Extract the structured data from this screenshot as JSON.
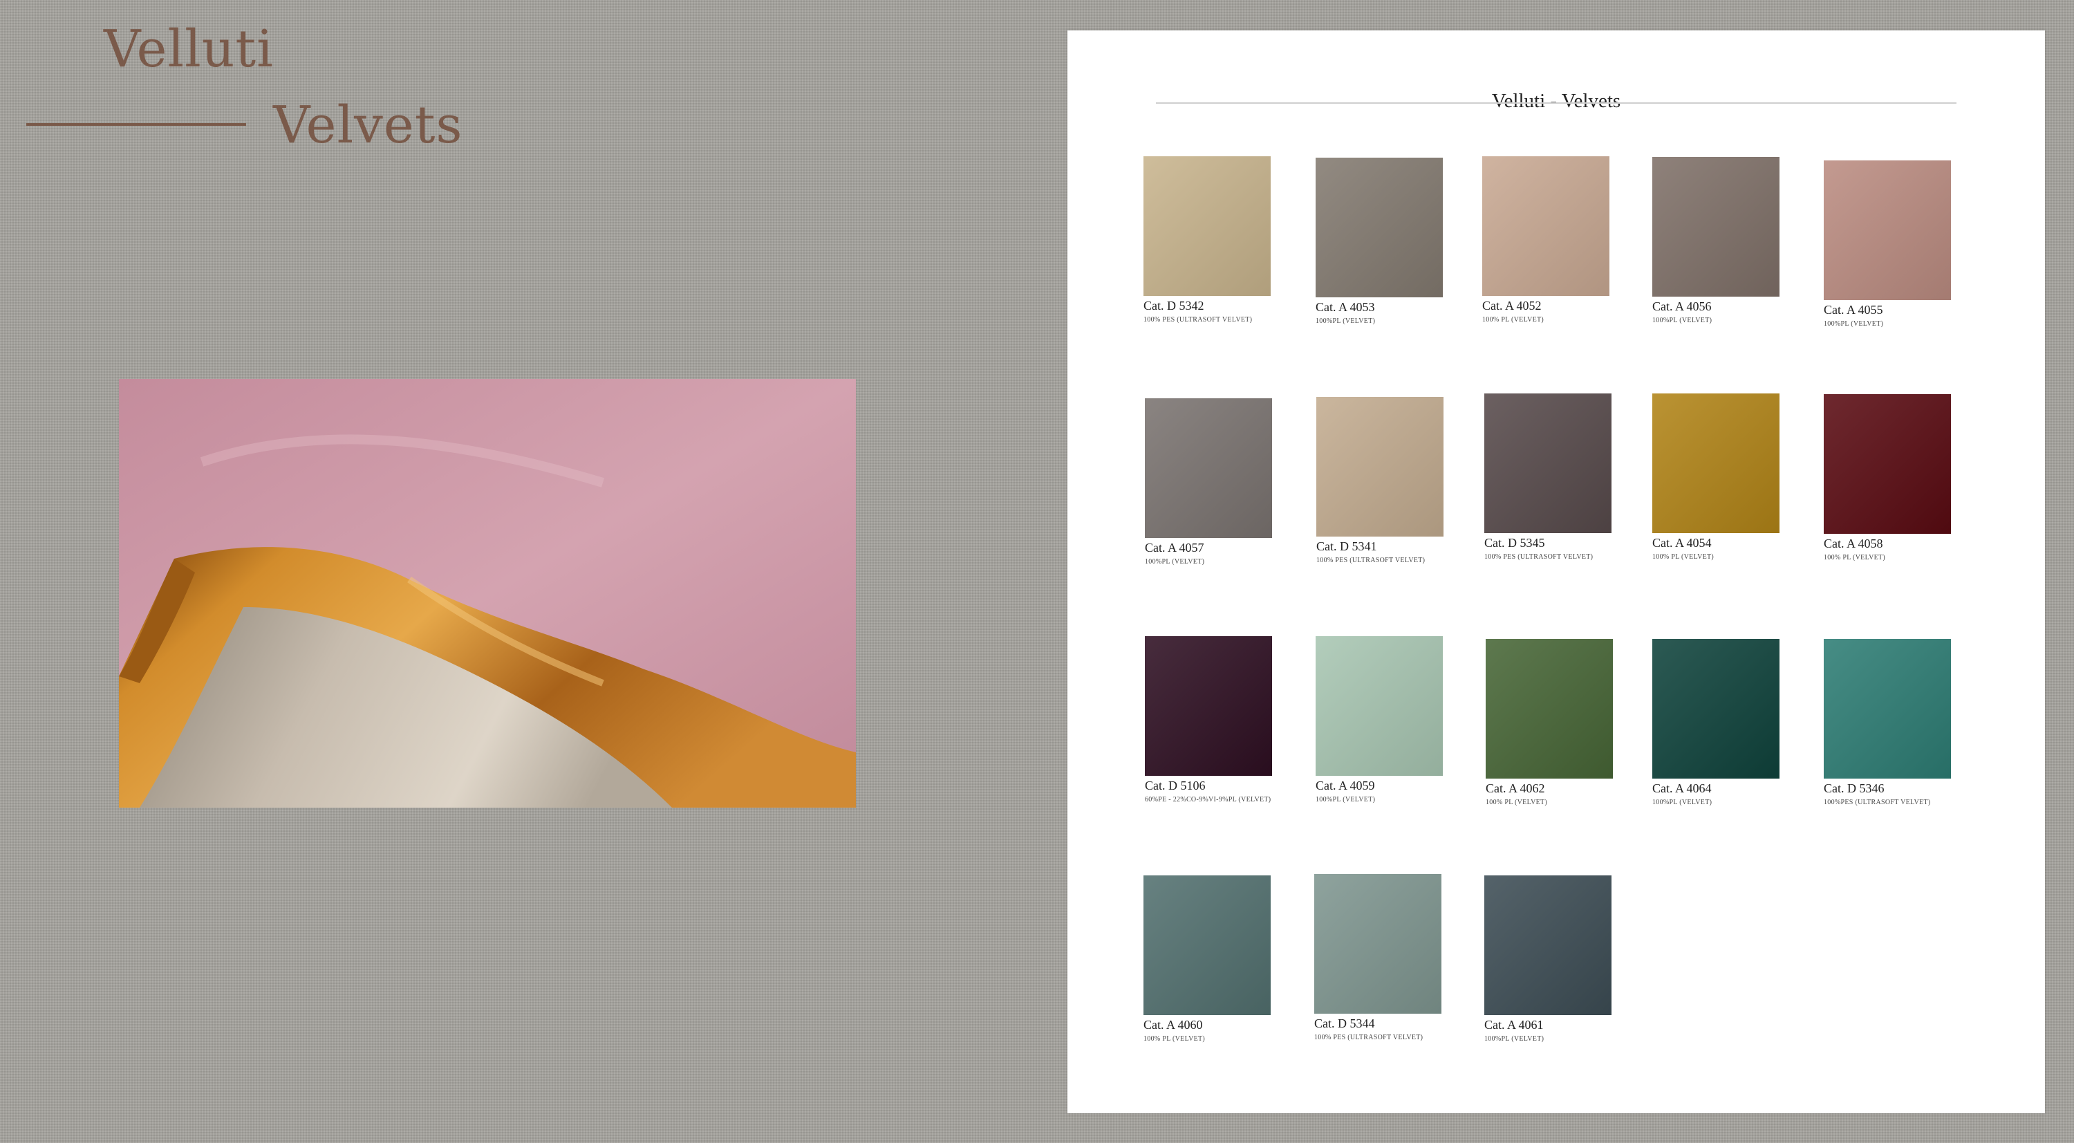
{
  "brand": {
    "title_it": "Velluti",
    "title_en": "Velvets"
  },
  "panel": {
    "title": "Velluti - Velvets"
  },
  "swatches": [
    {
      "code": "Cat. D 5342",
      "composition": "100% PES (ULTRASOFT VELVET)",
      "color": "#c8b48d"
    },
    {
      "code": "Cat. A 4053",
      "composition": "100%PL (VELVET)",
      "color": "#837a70"
    },
    {
      "code": "Cat. A 4052",
      "composition": "100% PL (VELVET)",
      "color": "#c9a993"
    },
    {
      "code": "Cat. A 4056",
      "composition": "100%PL (VELVET)",
      "color": "#7f7068"
    },
    {
      "code": "Cat. A 4055",
      "composition": "100%PL (VELVET)",
      "color": "#bb8c81"
    },
    {
      "code": "Cat. A 4057",
      "composition": "100%PL (VELVET)",
      "color": "#7a7370"
    },
    {
      "code": "Cat. D 5341",
      "composition": "100% PES (ULTRASOFT VELVET)",
      "color": "#c3ac90"
    },
    {
      "code": "Cat. D 5345",
      "composition": "100% PES (ULTRASOFT VELVET)",
      "color": "#574a4b"
    },
    {
      "code": "Cat. A 4054",
      "composition": "100% PL (VELVET)",
      "color": "#b18417"
    },
    {
      "code": "Cat. A 4058",
      "composition": "100% PL (VELVET)",
      "color": "#5a0b12"
    },
    {
      "code": "Cat. D 5106",
      "composition": "60%PE - 22%CO-9%VI-9%PL (VELVET)",
      "color": "#2e0f22"
    },
    {
      "code": "Cat. A 4059",
      "composition": "100%PL (VELVET)",
      "color": "#a8c6b2"
    },
    {
      "code": "Cat. A 4062",
      "composition": "100% PL (VELVET)",
      "color": "#476636"
    },
    {
      "code": "Cat. A 4064",
      "composition": "100%PL (VELVET)",
      "color": "#0f433c"
    },
    {
      "code": "Cat. D 5346",
      "composition": "100%PES (ULTRASOFT VELVET)",
      "color": "#2d7d74"
    },
    {
      "code": "Cat. A 4060",
      "composition": "100% PL (VELVET)",
      "color": "#52706f"
    },
    {
      "code": "Cat. D 5344",
      "composition": "100% PES (ULTRASOFT VELVET)",
      "color": "#7f9690"
    },
    {
      "code": "Cat. A 4061",
      "composition": "100%PL (VELVET)",
      "color": "#3d4d55"
    }
  ]
}
